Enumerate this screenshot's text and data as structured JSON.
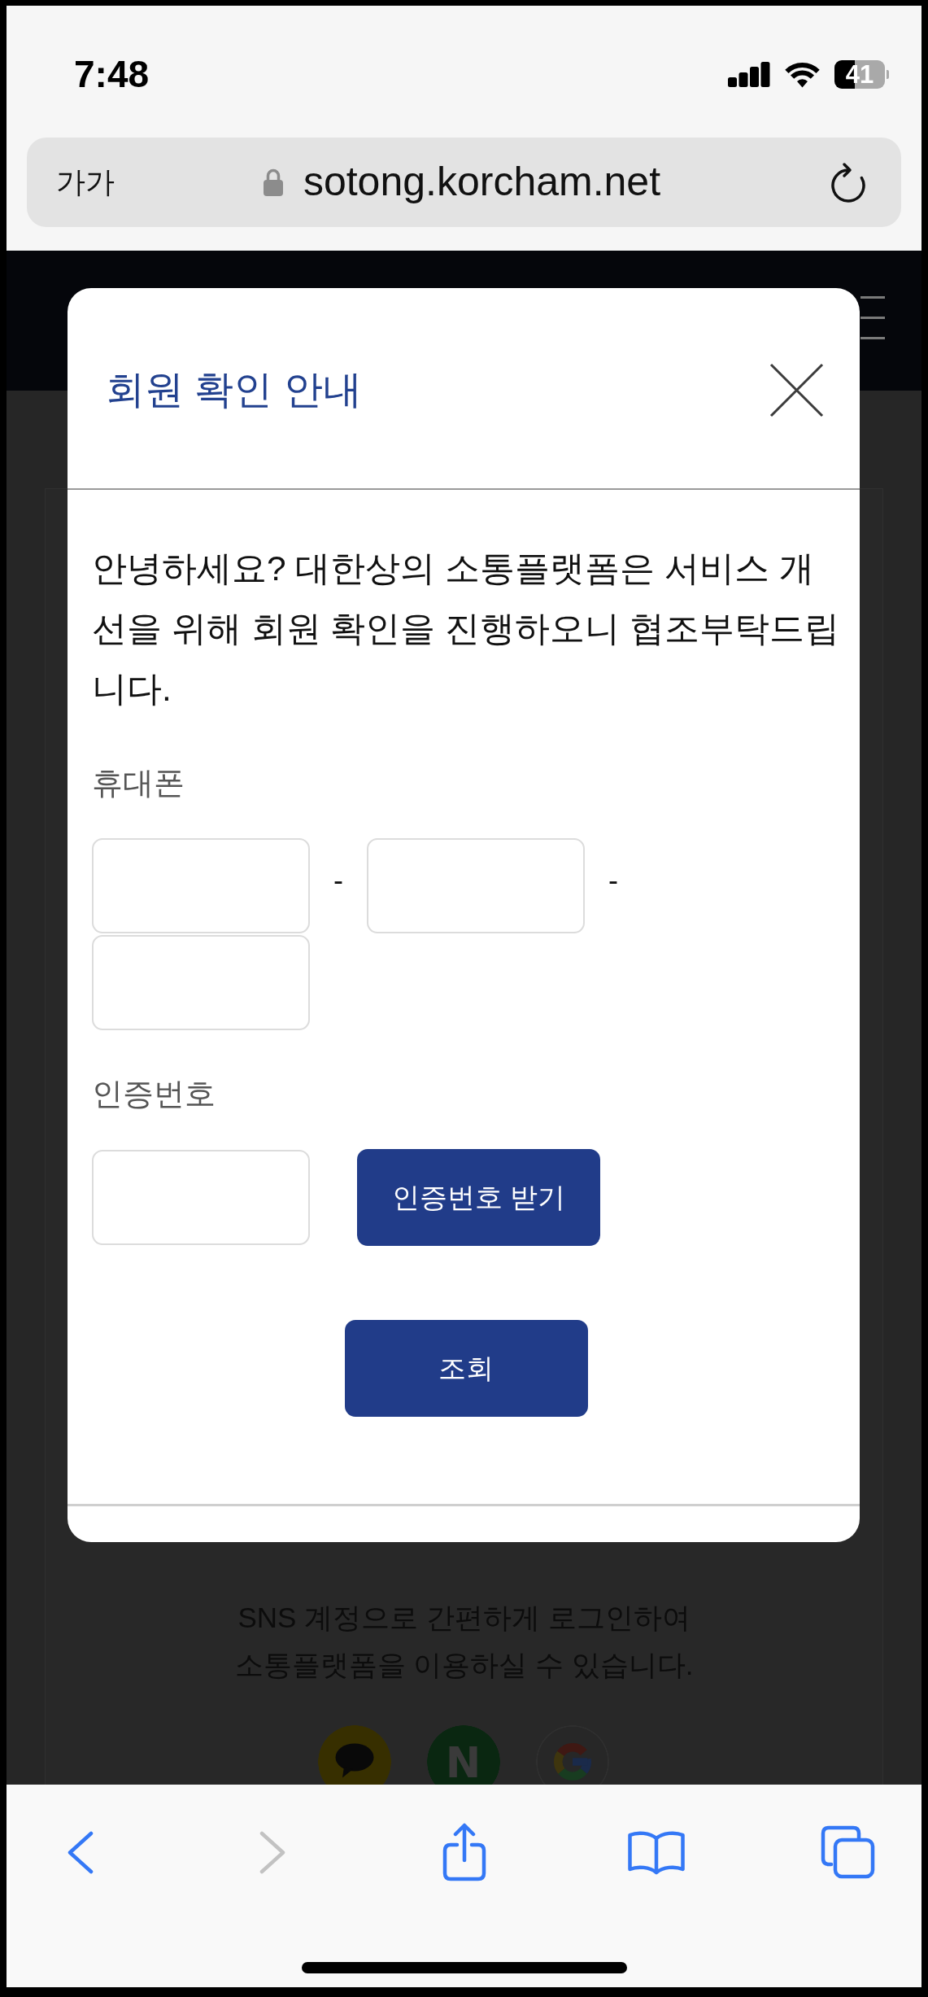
{
  "status_bar": {
    "time": "7:48",
    "battery": "41"
  },
  "address_bar": {
    "text_size_button": "가가",
    "secure": true,
    "url": "sotong.korcham.net"
  },
  "dialog": {
    "title": "회원 확인 안내",
    "message": "안녕하세요? 대한상의 소통플랫폼은 서비스 개선을 위해 회원 확인을 진행하오니 협조부탁드립니다.",
    "fields": [
      {
        "label": "휴대폰",
        "parts": [
          {
            "kind": "input"
          },
          {
            "kind": "separator",
            "text": "-"
          },
          {
            "kind": "input"
          },
          {
            "kind": "separator",
            "text": "-"
          },
          {
            "kind": "input"
          }
        ]
      },
      {
        "label": "인증번호",
        "parts": [
          {
            "kind": "input"
          },
          {
            "kind": "button",
            "text": "인증번호 받기"
          }
        ]
      }
    ],
    "submit_button": "조회"
  },
  "page": {
    "description": "SNS 계정으로 간편하게 로그인하여 소통플랫폼을 이용하실 수 있습니다.",
    "login_buttons": [
      {
        "kind": "speech-bubble"
      },
      {
        "kind": "letter",
        "label": "N"
      },
      {
        "kind": "g-mark"
      }
    ]
  },
  "toolbar": [
    {
      "kind": "back",
      "disabled": false
    },
    {
      "kind": "forward",
      "disabled": true
    },
    {
      "kind": "share",
      "disabled": false
    },
    {
      "kind": "bookmarks",
      "disabled": false
    },
    {
      "kind": "tabs",
      "disabled": false
    }
  ]
}
